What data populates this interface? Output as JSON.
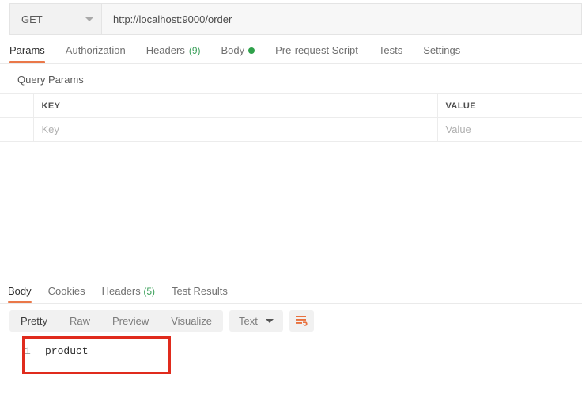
{
  "request_bar": {
    "method": "GET",
    "method_icon": "chevron-down-icon",
    "url": "http://localhost:9000/order"
  },
  "request_tabs": [
    {
      "label": "Params",
      "active": true
    },
    {
      "label": "Authorization",
      "active": false
    },
    {
      "label": "Headers",
      "count": "(9)",
      "active": false
    },
    {
      "label": "Body",
      "dot": true,
      "active": false
    },
    {
      "label": "Pre-request Script",
      "active": false
    },
    {
      "label": "Tests",
      "active": false
    },
    {
      "label": "Settings",
      "active": false
    }
  ],
  "query_params": {
    "section_title": "Query Params",
    "columns": [
      "KEY",
      "VALUE"
    ],
    "rows": [
      {
        "key_placeholder": "Key",
        "value_placeholder": "Value"
      }
    ]
  },
  "response_tabs": [
    {
      "label": "Body",
      "active": true
    },
    {
      "label": "Cookies",
      "active": false
    },
    {
      "label": "Headers",
      "count": "(5)",
      "active": false
    },
    {
      "label": "Test Results",
      "active": false
    }
  ],
  "response_toolbar": {
    "views": [
      {
        "label": "Pretty",
        "active": true
      },
      {
        "label": "Raw",
        "active": false
      },
      {
        "label": "Preview",
        "active": false
      },
      {
        "label": "Visualize",
        "active": false
      }
    ],
    "format": "Text",
    "format_icon": "chevron-down-icon",
    "wrap_icon": "wrap-text-icon"
  },
  "response_body": {
    "lines": [
      {
        "number": "1",
        "text": "product"
      }
    ]
  },
  "colors": {
    "accent_orange": "#ea7849",
    "green": "#2fa14b",
    "green_count": "#3ba05a",
    "annotation_red": "#e02b1d",
    "toolbar_gray": "#f1f1f1"
  }
}
